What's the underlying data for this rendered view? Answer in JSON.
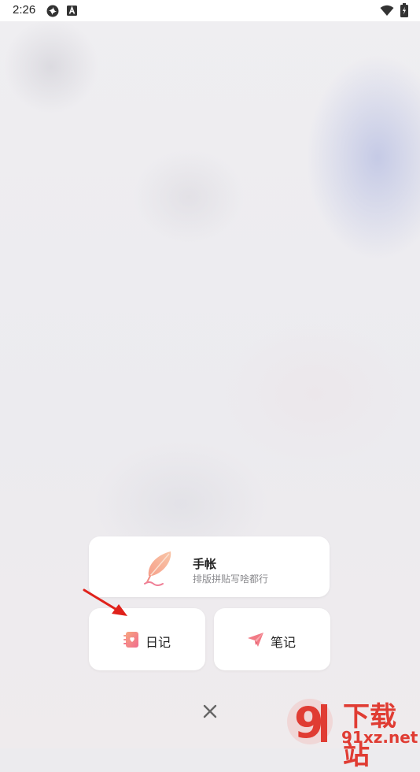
{
  "status_bar": {
    "time": "2:26",
    "icons": [
      "sync-icon",
      "accessibility-a-icon",
      "wifi-icon",
      "battery-icon"
    ]
  },
  "menu": {
    "handbook": {
      "title": "手帐",
      "subtitle": "排版拼贴写啥都行",
      "icon": "feather-icon"
    },
    "diary": {
      "label": "日记",
      "icon": "diary-book-icon"
    },
    "notes": {
      "label": "笔记",
      "icon": "paper-plane-icon"
    },
    "close": {
      "icon": "close-icon"
    }
  },
  "annotation": {
    "icon": "red-arrow-icon",
    "color": "#e0221b"
  },
  "watermark": {
    "brand_text": "下载站",
    "site_text": "91xz.net",
    "logo_glyph": "9",
    "color": "#e03c33"
  }
}
